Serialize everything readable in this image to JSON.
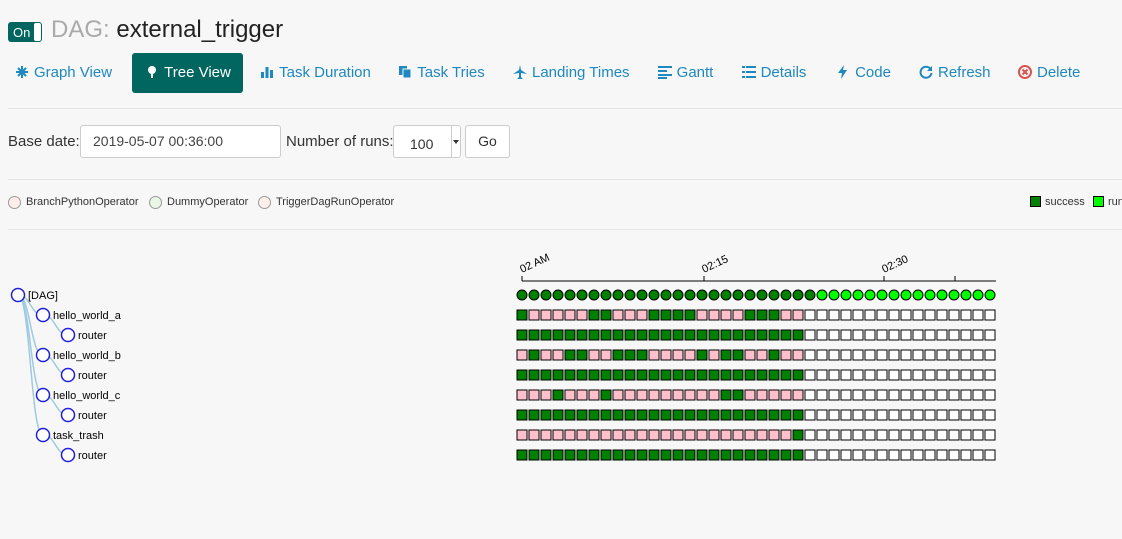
{
  "header": {
    "toggle_label": "On",
    "dag_prefix": "DAG:",
    "dag_name": "external_trigger"
  },
  "nav": [
    {
      "label": "Graph View",
      "icon": "asterisk-icon",
      "active": false
    },
    {
      "label": "Tree View",
      "icon": "tree-icon",
      "active": true
    },
    {
      "label": "Task Duration",
      "icon": "bar-chart-icon",
      "active": false
    },
    {
      "label": "Task Tries",
      "icon": "duplicate-icon",
      "active": false
    },
    {
      "label": "Landing Times",
      "icon": "plane-icon",
      "active": false
    },
    {
      "label": "Gantt",
      "icon": "align-left-icon",
      "active": false
    },
    {
      "label": "Details",
      "icon": "list-icon",
      "active": false
    },
    {
      "label": "Code",
      "icon": "flash-icon",
      "active": false
    },
    {
      "label": "Refresh",
      "icon": "refresh-icon",
      "active": false
    },
    {
      "label": "Delete",
      "icon": "remove-circle-icon",
      "active": false
    }
  ],
  "form": {
    "base_date_label": "Base date:",
    "base_date_value": "2019-05-07 00:36:00",
    "runs_label": "Number of runs:",
    "runs_value": "100",
    "go_label": "Go"
  },
  "operators": [
    {
      "name": "BranchPythonOperator",
      "color": "#ffefeb"
    },
    {
      "name": "DummyOperator",
      "color": "#e8f7e4"
    },
    {
      "name": "TriggerDagRunOperator",
      "color": "#ffefeb"
    }
  ],
  "states": [
    {
      "name": "success",
      "color": "#008000"
    },
    {
      "name": "running",
      "visible_text": "run",
      "color": "#00ff00"
    }
  ],
  "time_axis": {
    "ticks": [
      "02 AM",
      "02:15",
      "02:30"
    ]
  },
  "tree_nodes": [
    {
      "label": "[DAG]",
      "depth": 0
    },
    {
      "label": "hello_world_a",
      "depth": 1
    },
    {
      "label": "router",
      "depth": 2
    },
    {
      "label": "hello_world_b",
      "depth": 1
    },
    {
      "label": "router",
      "depth": 2
    },
    {
      "label": "hello_world_c",
      "depth": 1
    },
    {
      "label": "router",
      "depth": 2
    },
    {
      "label": "task_trash",
      "depth": 1
    },
    {
      "label": "router",
      "depth": 2
    }
  ],
  "status_colors": {
    "S": "#008000",
    "P": "#ffc0cb",
    "N": "#ffffff",
    "R": "#00ff00"
  },
  "grid_rows": [
    "SSSSSSSSSSSSSSSSSSSSSSSSSRRRRRRRRRRRRRRR",
    "SPPPPPSSPPPSSSSPPPPSSSPPNNNNNNNNNNNNNNNN",
    "SSSSSSSSSSSSSSSSSSSSSSSSNNNNNNNNNNNNNNNN",
    "PSPPSSPPSSSPPPPSPSSPPSPPNNNNNNNNNNNNNNNN",
    "SSSSSSSSSSSSSSSSSSSSSSSSNNNNNNNNNNNNNNNN",
    "PPPSPPPSPPPPPPPPPSSPPPPPNNNNNNNNNNNNNNNN",
    "SSSSSSSSSSSSSSSSSSSSSSSSNNNNNNNNNNNNNNNN",
    "PPPPPPPPPPPPPPPPPPPPPPPSNNNNNNNNNNNNNNNN",
    "SSSSSSSSSSSSSSSSSSSSSSSSNNNNNNNNNNNNNNNN"
  ]
}
